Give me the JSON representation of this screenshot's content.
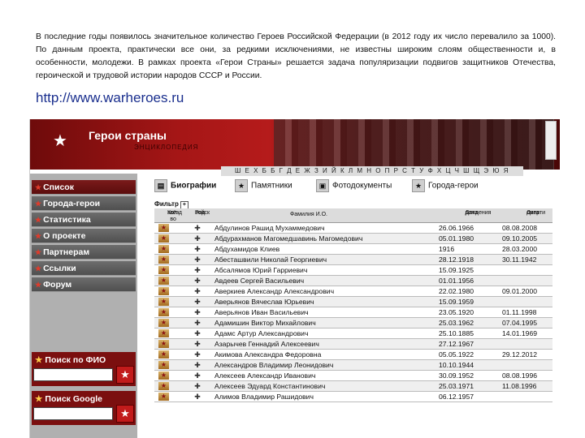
{
  "slide": {
    "intro_text": "В последние годы появилось значительное количество Героев Российской Федерации (в 2012 году их число перевалило за 1000). По данным проекта, практически все они, за редкими исключениями, не известны широким слоям общественности и, в особенности, молодежи. В рамках проекта «Герои Страны» решается задача популяризации подвигов защитников Отечества, героической и трудовой истории народов СССР и России.",
    "url": "http://www.warheroes.ru"
  },
  "site": {
    "title": "Герои страны",
    "banner_sub": "ЭНЦИКЛОПЕДИЯ",
    "strip_text": "Ш Е Х Б Б Г Д Е Ж З И Й К Л М Н О П Р С Т У Ф Х Ц Ч Ш Щ Э Ю Я",
    "nav": [
      "Список",
      "Города-герои",
      "Статистика",
      "О проекте",
      "Партнерам",
      "Ссылки",
      "Форум"
    ],
    "search_fio_label": "Поиск по ФИО",
    "search_google_label": "Поиск Google",
    "tabs": [
      "Биографии",
      "Памятники",
      "Фотодокументы",
      "Города-герои"
    ],
    "filter_label": "Фильтр",
    "columns": {
      "count": "Кол-во",
      "awards": "звёзд",
      "branch": "Род",
      "branch2": "войск",
      "name": "Фамилия И.О.",
      "birth": "Дата",
      "birth2": "рождения",
      "death": "Дата",
      "death2": "смерти"
    },
    "rows": [
      {
        "name": "Абдулинов Рашид Мухаммедович",
        "birth": "26.06.1966",
        "death": "08.08.2008"
      },
      {
        "name": "Абдурахманов Магомедшавинь Магомедович",
        "birth": "05.01.1980",
        "death": "09.10.2005"
      },
      {
        "name": "Абдухамидов Клиев",
        "birth": "1916",
        "death": "28.03.2000"
      },
      {
        "name": "Абесташвили Николай Георгиевич",
        "birth": "28.12.1918",
        "death": "30.11.1942"
      },
      {
        "name": "Абсалямов Юрий Гарриевич",
        "birth": "15.09.1925",
        "death": ""
      },
      {
        "name": "Авдеев Сергей Васильевич",
        "birth": "01.01.1956",
        "death": ""
      },
      {
        "name": "Аверкиев Александр Александрович",
        "birth": "22.02.1980",
        "death": "09.01.2000"
      },
      {
        "name": "Аверьянов Вячеслав Юрьевич",
        "birth": "15.09.1959",
        "death": ""
      },
      {
        "name": "Аверьянов Иван Васильевич",
        "birth": "23.05.1920",
        "death": "01.11.1998"
      },
      {
        "name": "Адамишин Виктор Михайлович",
        "birth": "25.03.1962",
        "death": "07.04.1995"
      },
      {
        "name": "Адамс Артур Александрович",
        "birth": "25.10.1885",
        "death": "14.01.1969"
      },
      {
        "name": "Азарычев Геннадий Алексеевич",
        "birth": "27.12.1967",
        "death": ""
      },
      {
        "name": "Акимова Александра Федоровна",
        "birth": "05.05.1922",
        "death": "29.12.2012"
      },
      {
        "name": "Александров Владимир Леонидович",
        "birth": "10.10.1944",
        "death": ""
      },
      {
        "name": "Алексеев Александр Иванович",
        "birth": "30.09.1952",
        "death": "08.08.1996"
      },
      {
        "name": "Алексеев Эдуард Константинович",
        "birth": "25.03.1971",
        "death": "11.08.1996"
      },
      {
        "name": "Алимов Владимир Рашидович",
        "birth": "06.12.1957",
        "death": ""
      }
    ]
  }
}
